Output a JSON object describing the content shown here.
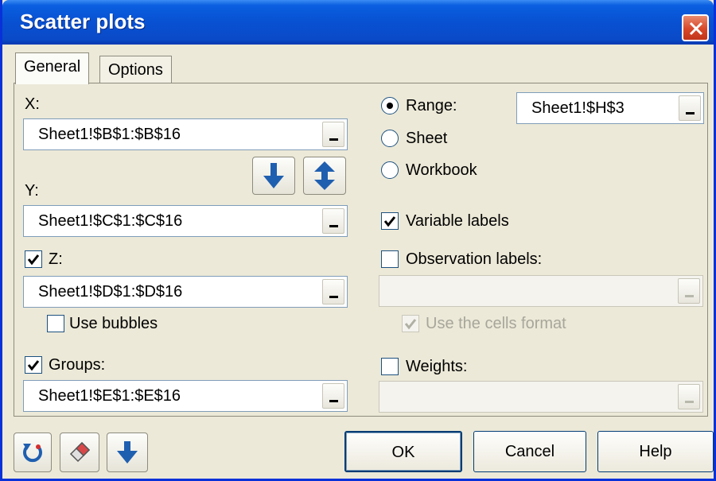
{
  "window": {
    "title": "Scatter plots"
  },
  "tabs": [
    {
      "label": "General"
    },
    {
      "label": "Options"
    }
  ],
  "x": {
    "label": "X:",
    "value": "Sheet1!$B$1:$B$16"
  },
  "y": {
    "label": "Y:",
    "value": "Sheet1!$C$1:$C$16"
  },
  "z": {
    "label": "Z:",
    "value": "Sheet1!$D$1:$D$16",
    "checked": true
  },
  "bubbles": {
    "label": "Use bubbles",
    "checked": false
  },
  "groups": {
    "label": "Groups:",
    "value": "Sheet1!$E$1:$E$16",
    "checked": true
  },
  "output": {
    "range_label": "Range:",
    "range_value": "Sheet1!$H$3",
    "sheet_label": "Sheet",
    "workbook_label": "Workbook",
    "selected": "Range"
  },
  "variable_labels": {
    "label": "Variable labels",
    "checked": true
  },
  "observation_labels": {
    "label": "Observation labels:",
    "checked": false,
    "value": ""
  },
  "cells_format": {
    "label": "Use the cells format",
    "checked": true,
    "enabled": false
  },
  "weights": {
    "label": "Weights:",
    "checked": false,
    "value": ""
  },
  "buttons": {
    "ok": "OK",
    "cancel": "Cancel",
    "help": "Help"
  },
  "colors": {
    "title_bar": "#0a5fe0",
    "accent_blue": "#1f5fb0",
    "close_red": "#d8472a"
  }
}
